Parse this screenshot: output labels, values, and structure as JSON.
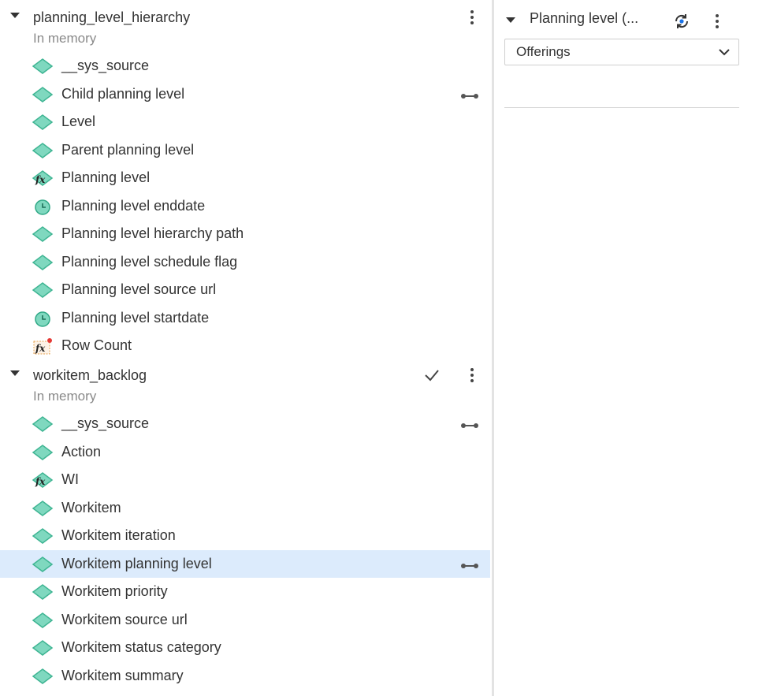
{
  "sources": [
    {
      "name": "planning_level_hierarchy",
      "subtitle": "In memory",
      "fields": [
        {
          "label": "__sys_source",
          "icon": "dimension-diamond-icon"
        },
        {
          "label": "Child planning level",
          "icon": "dimension-diamond-icon",
          "link": true
        },
        {
          "label": "Level",
          "icon": "dimension-diamond-icon"
        },
        {
          "label": "Parent planning level",
          "icon": "dimension-diamond-icon"
        },
        {
          "label": "Planning level",
          "icon": "calculated-dimension-icon"
        },
        {
          "label": "Planning level enddate",
          "icon": "clock-icon"
        },
        {
          "label": "Planning level hierarchy path",
          "icon": "dimension-diamond-icon"
        },
        {
          "label": "Planning level schedule flag",
          "icon": "dimension-diamond-icon"
        },
        {
          "label": "Planning level source url",
          "icon": "dimension-diamond-icon"
        },
        {
          "label": "Planning level startdate",
          "icon": "clock-icon"
        },
        {
          "label": "Row Count",
          "icon": "calculated-measure-icon"
        }
      ]
    },
    {
      "name": "workitem_backlog",
      "subtitle": "In memory",
      "checked": true,
      "fields": [
        {
          "label": "__sys_source",
          "icon": "dimension-diamond-icon",
          "link": true
        },
        {
          "label": "Action",
          "icon": "dimension-diamond-icon"
        },
        {
          "label": "WI",
          "icon": "calculated-dimension-icon"
        },
        {
          "label": "Workitem",
          "icon": "dimension-diamond-icon"
        },
        {
          "label": "Workitem iteration",
          "icon": "dimension-diamond-icon"
        },
        {
          "label": "Workitem planning level",
          "icon": "dimension-diamond-icon",
          "link": true,
          "selected": true
        },
        {
          "label": "Workitem priority",
          "icon": "dimension-diamond-icon"
        },
        {
          "label": "Workitem source url",
          "icon": "dimension-diamond-icon"
        },
        {
          "label": "Workitem status category",
          "icon": "dimension-diamond-icon"
        },
        {
          "label": "Workitem summary",
          "icon": "dimension-diamond-icon"
        }
      ]
    }
  ],
  "right_panel": {
    "title": "Planning level (...",
    "select_value": "Offerings"
  },
  "colors": {
    "diamond_fill": "#7fd8bf",
    "diamond_stroke": "#3fb593",
    "selected_row": "#dcebfc",
    "accent_blue": "#1a73e8"
  }
}
